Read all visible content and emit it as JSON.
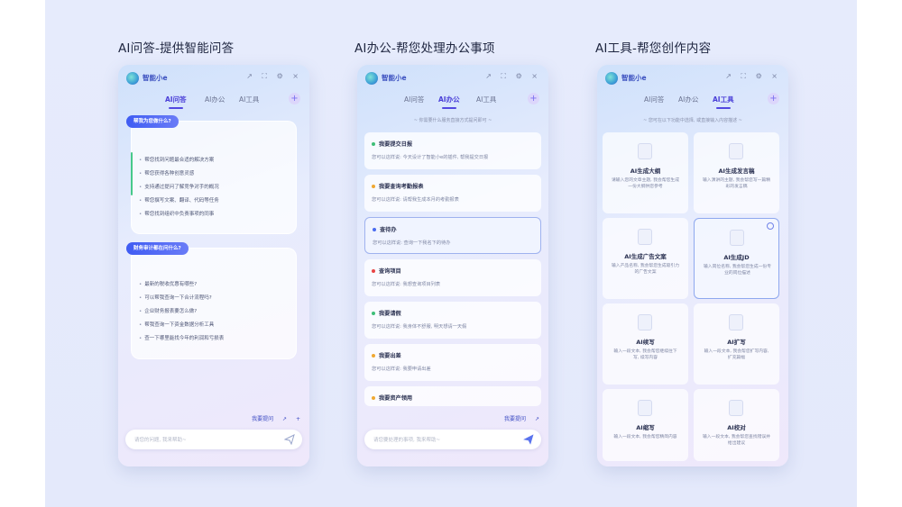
{
  "titles": {
    "left": "AI问答-提供智能问答",
    "mid": "AI办公-帮您处理办公事项",
    "right": "AI工具-帮您创作内容"
  },
  "app": {
    "name": "智能小e",
    "window_controls": "↗ ⛶ ⚙ ×"
  },
  "tabs": {
    "qa": "AI问答",
    "office": "AI办公",
    "tools": "AI工具",
    "plus": "+"
  },
  "panel1": {
    "card1": {
      "question": "帮我为您做什么?",
      "lines": [
        "帮您找到问题最合适的解决方案",
        "帮您获得各种创意灵感",
        "支持通过提问了解竞争对手的概况",
        "帮您撰写文案、翻译、代码等任务",
        "帮您找到组织中负责事项的同事"
      ]
    },
    "card2": {
      "question": "财务审计都在问什么?",
      "lines": [
        "最新的税收优惠有哪些?",
        "可以帮我查询一下合计流程吗?",
        "企业财务报表要怎么做?",
        "帮我查询一下资金数据分析工具",
        "查一下哪里能找今年的利润和亏损表"
      ]
    },
    "tools": {
      "history": "我要提问",
      "share": "↗",
      "add": "+"
    },
    "input_placeholder": "请您的问题, 我来帮助~"
  },
  "panel2": {
    "hint": "~ 你需要什么服务直接方式提问即可 ~",
    "items": [
      {
        "title": "我要提交日报",
        "desc": "您可以这样说: 今天设计了智能小e的插件, 帮我提交日报",
        "color": "#3fbf78"
      },
      {
        "title": "我要查询考勤报表",
        "desc": "您可以这样说: 请帮我生成本月的考勤报表",
        "color": "#f0a832"
      },
      {
        "title": "查待办",
        "desc": "您可以这样说: 查询一下我名下的待办",
        "color": "#4a6cf0"
      },
      {
        "title": "查询项目",
        "desc": "您可以这样说: 我想查询项目列表",
        "color": "#e84545"
      },
      {
        "title": "我要请假",
        "desc": "您可以这样说: 我身体不舒服, 明天想请一天假",
        "color": "#3fbf78"
      },
      {
        "title": "我要出差",
        "desc": "您可以这样说: 我要申请出差",
        "color": "#f0a832"
      },
      {
        "title": "我要资产领用",
        "desc": "",
        "color": "#f0a832"
      }
    ],
    "tools": {
      "history": "我要提问",
      "share": "↗"
    },
    "input_placeholder": "请您要处理的事项, 我来帮助~"
  },
  "panel3": {
    "hint": "~ 您可在以下功能中选择, 或直接输入内容描述 ~",
    "tiles": [
      {
        "title": "AI生成大纲",
        "desc": "请输入您的文章主题, 我会帮您生成一份大纲供您参考",
        "icon": "outline-doc-icon"
      },
      {
        "title": "AI生成发言稿",
        "desc": "输入演讲的主题, 我会帮您写一篇精彩的发言稿",
        "icon": "speech-mic-icon"
      },
      {
        "title": "AI生成广告文案",
        "desc": "输入产品名称, 我会帮您生成吸引力的广告文案",
        "icon": "ad-badge-icon"
      },
      {
        "title": "AI生成JD",
        "desc": "输入岗位名称, 我会帮您生成一份专业的岗位描述",
        "icon": "person-doc-icon"
      },
      {
        "title": "AI续写",
        "desc": "输入一段文本, 我会帮您继续往下写, 续写内容",
        "icon": "continue-doc-icon"
      },
      {
        "title": "AI扩写",
        "desc": "输入一段文本, 我会帮您扩写内容, 扩充篇幅",
        "icon": "expand-pen-icon"
      },
      {
        "title": "AI缩写",
        "desc": "输入一段文本, 我会帮您精简内容",
        "icon": "shrink-pen-icon"
      },
      {
        "title": "AI校对",
        "desc": "输入一段文本, 我会帮您查找错误并给出建议",
        "icon": "proofread-icon"
      }
    ]
  }
}
